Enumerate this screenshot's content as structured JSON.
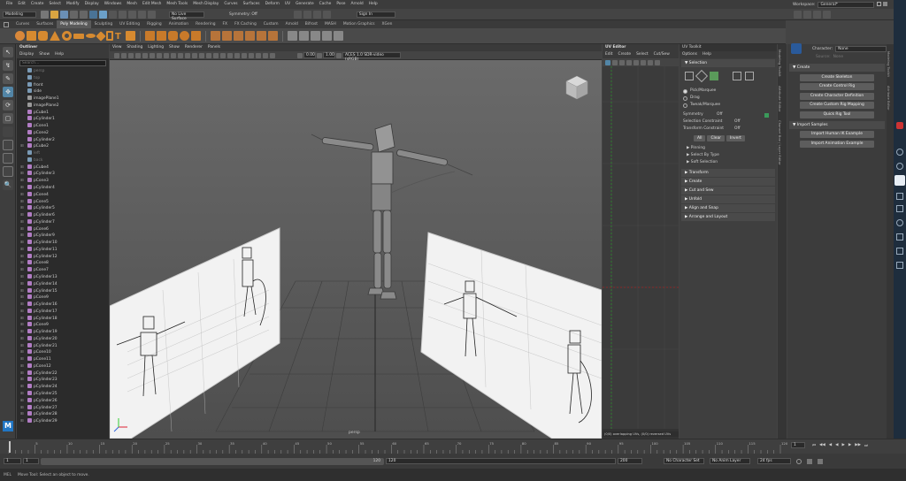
{
  "menubar": {
    "items": [
      "File",
      "Edit",
      "Create",
      "Select",
      "Modify",
      "Display",
      "Windows",
      "Mesh",
      "Edit Mesh",
      "Mesh Tools",
      "Mesh Display",
      "Curves",
      "Surfaces",
      "Deform",
      "UV",
      "Generate",
      "Cache",
      "Pose",
      "Arnold",
      "Help"
    ],
    "workspace_label": "Workspace:",
    "workspace_value": "General*"
  },
  "statusline": {
    "mode": "Modeling",
    "live_surface": "No Live Surface",
    "symmetry": "Symmetry: Off",
    "user_label": "Sign In"
  },
  "shelf": {
    "tabs": [
      "Curves",
      "Surfaces",
      "Poly Modeling",
      "Sculpting",
      "UV Editing",
      "Rigging",
      "Animation",
      "Rendering",
      "FX",
      "FX Caching",
      "Custom",
      "Arnold",
      "Bifrost",
      "MASH",
      "Motion Graphics",
      "XGen"
    ],
    "active_tab": "Poly Modeling",
    "accent": "#e0922f"
  },
  "toolbox": {
    "tools": [
      "select-tool-icon",
      "lasso-tool-icon",
      "paint-tool-icon",
      "move-tool-icon",
      "rotate-tool-icon",
      "scale-tool-icon",
      "last-tool-icon",
      "layout-single-icon",
      "layout-four-icon",
      "layout-side-icon",
      "outliner-icon"
    ],
    "active_index": 3
  },
  "outliner": {
    "title": "Outliner",
    "menu": [
      "Display",
      "Show",
      "Help"
    ],
    "search_placeholder": "Search...",
    "items": [
      {
        "label": "persp",
        "type": "camera",
        "dim": true,
        "expandable": false
      },
      {
        "label": "top",
        "type": "camera",
        "dim": true,
        "expandable": false
      },
      {
        "label": "front",
        "type": "camera",
        "dim": false,
        "expandable": false
      },
      {
        "label": "side",
        "type": "camera",
        "dim": false,
        "expandable": false
      },
      {
        "label": "imagePlane1",
        "type": "image",
        "dim": false,
        "expandable": false
      },
      {
        "label": "imagePlane2",
        "type": "image",
        "dim": false,
        "expandable": false
      },
      {
        "label": "pCube1",
        "type": "mesh",
        "dim": false,
        "expandable": false
      },
      {
        "label": "pCylinder1",
        "type": "mesh",
        "dim": false,
        "expandable": false
      },
      {
        "label": "pCone1",
        "type": "mesh",
        "dim": false,
        "expandable": false
      },
      {
        "label": "pCone2",
        "type": "mesh",
        "dim": false,
        "expandable": false
      },
      {
        "label": "pCylinder2",
        "type": "mesh",
        "dim": false,
        "expandable": false
      },
      {
        "label": "pCube2",
        "type": "mesh",
        "dim": false,
        "expandable": true
      },
      {
        "label": "left",
        "type": "camera",
        "dim": true,
        "expandable": false
      },
      {
        "label": "back",
        "type": "camera",
        "dim": true,
        "expandable": false
      },
      {
        "label": "pCube4",
        "type": "mesh",
        "dim": false,
        "expandable": true
      },
      {
        "label": "pCylinder3",
        "type": "mesh",
        "dim": false,
        "expandable": true
      },
      {
        "label": "pCone3",
        "type": "mesh",
        "dim": false,
        "expandable": true
      },
      {
        "label": "pCylinder4",
        "type": "mesh",
        "dim": false,
        "expandable": true
      },
      {
        "label": "pCone4",
        "type": "mesh",
        "dim": false,
        "expandable": true
      },
      {
        "label": "pCone5",
        "type": "mesh",
        "dim": false,
        "expandable": true
      },
      {
        "label": "pCylinder5",
        "type": "mesh",
        "dim": false,
        "expandable": true
      },
      {
        "label": "pCylinder6",
        "type": "mesh",
        "dim": false,
        "expandable": true
      },
      {
        "label": "pCylinder7",
        "type": "mesh",
        "dim": false,
        "expandable": true
      },
      {
        "label": "pCone6",
        "type": "mesh",
        "dim": false,
        "expandable": true
      },
      {
        "label": "pCylinder9",
        "type": "mesh",
        "dim": false,
        "expandable": true
      },
      {
        "label": "pCylinder10",
        "type": "mesh",
        "dim": false,
        "expandable": true
      },
      {
        "label": "pCylinder11",
        "type": "mesh",
        "dim": false,
        "expandable": true
      },
      {
        "label": "pCylinder12",
        "type": "mesh",
        "dim": false,
        "expandable": true
      },
      {
        "label": "pCone8",
        "type": "mesh",
        "dim": false,
        "expandable": true
      },
      {
        "label": "pCone7",
        "type": "mesh",
        "dim": false,
        "expandable": true
      },
      {
        "label": "pCylinder13",
        "type": "mesh",
        "dim": false,
        "expandable": true
      },
      {
        "label": "pCylinder14",
        "type": "mesh",
        "dim": false,
        "expandable": true
      },
      {
        "label": "pCylinder15",
        "type": "mesh",
        "dim": false,
        "expandable": true
      },
      {
        "label": "pCone9",
        "type": "mesh",
        "dim": false,
        "expandable": true
      },
      {
        "label": "pCylinder16",
        "type": "mesh",
        "dim": false,
        "expandable": true
      },
      {
        "label": "pCylinder17",
        "type": "mesh",
        "dim": false,
        "expandable": true
      },
      {
        "label": "pCylinder18",
        "type": "mesh",
        "dim": false,
        "expandable": true
      },
      {
        "label": "pCone9",
        "type": "mesh",
        "dim": false,
        "expandable": true
      },
      {
        "label": "pCylinder19",
        "type": "mesh",
        "dim": false,
        "expandable": true
      },
      {
        "label": "pCylinder20",
        "type": "mesh",
        "dim": false,
        "expandable": true
      },
      {
        "label": "pCylinder21",
        "type": "mesh",
        "dim": false,
        "expandable": true
      },
      {
        "label": "pCone10",
        "type": "mesh",
        "dim": false,
        "expandable": true
      },
      {
        "label": "pCone11",
        "type": "mesh",
        "dim": false,
        "expandable": true
      },
      {
        "label": "pCone12",
        "type": "mesh",
        "dim": false,
        "expandable": true
      },
      {
        "label": "pCylinder22",
        "type": "mesh",
        "dim": false,
        "expandable": true
      },
      {
        "label": "pCylinder23",
        "type": "mesh",
        "dim": false,
        "expandable": true
      },
      {
        "label": "pCylinder24",
        "type": "mesh",
        "dim": false,
        "expandable": true
      },
      {
        "label": "pCylinder25",
        "type": "mesh",
        "dim": false,
        "expandable": true
      },
      {
        "label": "pCylinder26",
        "type": "mesh",
        "dim": false,
        "expandable": true
      },
      {
        "label": "pCylinder27",
        "type": "mesh",
        "dim": false,
        "expandable": true
      },
      {
        "label": "pCylinder28",
        "type": "mesh",
        "dim": false,
        "expandable": true
      },
      {
        "label": "pCylinder29",
        "type": "mesh",
        "dim": false,
        "expandable": true
      }
    ]
  },
  "viewport": {
    "menu": [
      "View",
      "Shading",
      "Lighting",
      "Show",
      "Renderer",
      "Panels"
    ],
    "exposure": "0.00",
    "gamma": "1.00",
    "color_space": "ACES 1.0 SDR-video (sRGB)",
    "camera_label": "persp"
  },
  "uv_editor": {
    "title": "UV Editor",
    "menu": [
      "Edit",
      "Create",
      "Select",
      "Cut/Sew"
    ],
    "footer": "(0/0) overlapping UVs, (0/0) reversed UVs"
  },
  "uv_toolkit": {
    "title": "UV Toolkit",
    "menu": [
      "Options",
      "Help"
    ],
    "selection_header": "Selection",
    "radio_options": [
      "Pick/Marquee",
      "Drag",
      "Tweak/Marquee"
    ],
    "radio_selected": 0,
    "symmetry_label": "Symmetry",
    "symmetry_value": "Off",
    "selection_constraint_label": "Selection Constraint",
    "selection_constraint_value": "Off",
    "transform_constraint_label": "Transform Constraint",
    "transform_constraint_value": "Off",
    "buttons": [
      "All",
      "Clear",
      "Invert"
    ],
    "sub_sections": [
      "Pinning",
      "Select By Type",
      "Soft Selection"
    ],
    "sections": [
      "Transform",
      "Create",
      "Cut and Sew",
      "Unfold",
      "Align and Snap",
      "Arrange and Layout"
    ]
  },
  "hik": {
    "character_label": "Character:",
    "character_value": "None",
    "source_label": "Source:",
    "source_value": "None",
    "create_header": "Create",
    "create_buttons": [
      "Create Skeleton",
      "Create Control Rig",
      "Create Character Definition",
      "Create Custom Rig Mapping",
      "Quick Rig Tool"
    ],
    "import_header": "Import Samples",
    "import_buttons": [
      "Import Human IK Example",
      "Import Animation Example"
    ]
  },
  "side_tabs": {
    "left": [
      "Modeling Toolkit",
      "Attribute Editor",
      "Channel Box / Layer Editor"
    ],
    "right": [
      "Modeling Toolkit",
      "Attribute Editor"
    ]
  },
  "timeline": {
    "ticks": [
      "5",
      "10",
      "15",
      "20",
      "25",
      "30",
      "35",
      "40",
      "45",
      "50",
      "55",
      "60",
      "65",
      "70",
      "75",
      "80",
      "85",
      "90",
      "95",
      "100",
      "105",
      "110",
      "115",
      "120"
    ],
    "current_frame": "1"
  },
  "range": {
    "start": "1",
    "range_start": "1",
    "range_end": "120",
    "end": "120",
    "anim_end": "200",
    "character_set": "No Character Set",
    "anim_layer": "No Anim Layer",
    "fps": "24 fps"
  },
  "helpline": {
    "mel_label": "MEL",
    "message": "Move Tool: Select an object to move."
  }
}
